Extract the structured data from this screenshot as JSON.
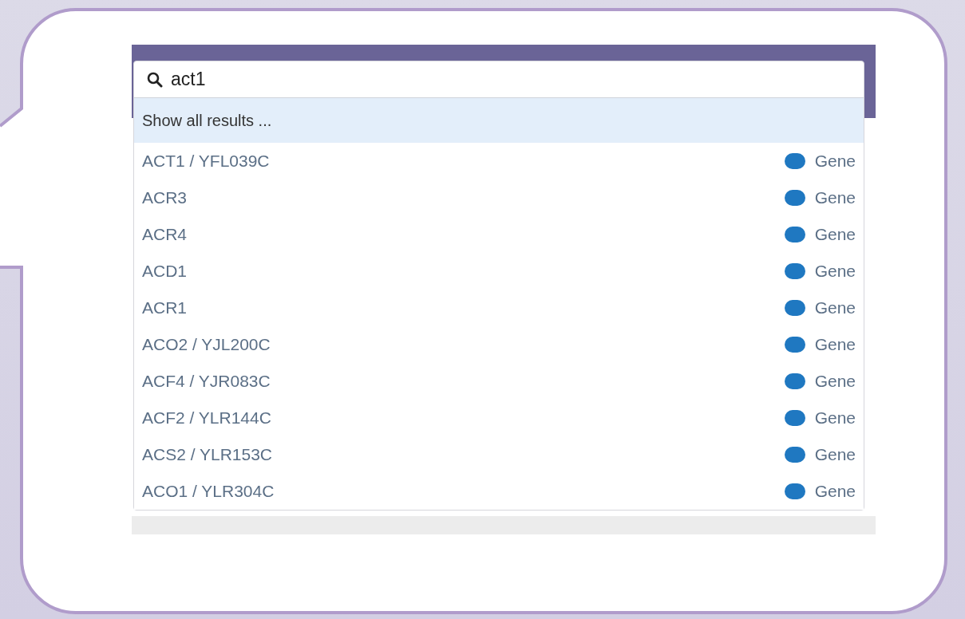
{
  "search": {
    "value": "act1"
  },
  "show_all": {
    "label": "Show all results ...",
    "selected": true
  },
  "results": [
    {
      "name": "ACT1 / YFL039C",
      "type": "Gene",
      "color": "#1f78c1",
      "selected": false
    },
    {
      "name": "ACR3",
      "type": "Gene",
      "color": "#1f78c1",
      "selected": false
    },
    {
      "name": "ACR4",
      "type": "Gene",
      "color": "#1f78c1",
      "selected": false
    },
    {
      "name": "ACD1",
      "type": "Gene",
      "color": "#1f78c1",
      "selected": false
    },
    {
      "name": "ACR1",
      "type": "Gene",
      "color": "#1f78c1",
      "selected": false
    },
    {
      "name": "ACO2 / YJL200C",
      "type": "Gene",
      "color": "#1f78c1",
      "selected": false
    },
    {
      "name": "ACF4 / YJR083C",
      "type": "Gene",
      "color": "#1f78c1",
      "selected": false
    },
    {
      "name": "ACF2 / YLR144C",
      "type": "Gene",
      "color": "#1f78c1",
      "selected": false
    },
    {
      "name": "ACS2 / YLR153C",
      "type": "Gene",
      "color": "#1f78c1",
      "selected": false
    },
    {
      "name": "ACO1 / YLR304C",
      "type": "Gene",
      "color": "#1f78c1",
      "selected": false
    }
  ]
}
